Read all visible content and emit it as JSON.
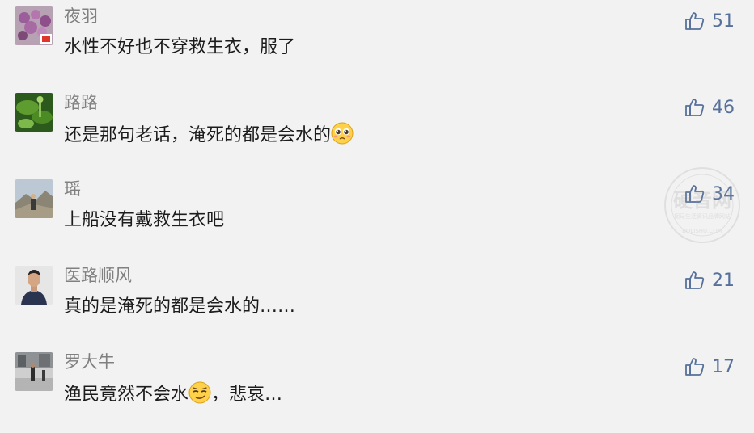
{
  "comments": [
    {
      "name": "夜羽",
      "text": "水性不好也不穿救生衣，服了",
      "likes": "51",
      "avatar_icon": "purple-flower-avatar"
    },
    {
      "name": "路路",
      "text": "还是那句老话，淹死的都是会水的",
      "emoji": "pleading-face-emoji",
      "likes": "46",
      "avatar_icon": "green-plant-avatar"
    },
    {
      "name": "瑶",
      "text": "上船没有戴救生衣吧",
      "likes": "34",
      "avatar_icon": "mountain-photo-avatar"
    },
    {
      "name": "医路顺风",
      "text": "真的是淹死的都是会水的……",
      "likes": "21",
      "avatar_icon": "man-portrait-avatar"
    },
    {
      "name": "罗大牛",
      "text": "渔民竟然不会水",
      "emoji": "smirk-face-emoji",
      "text_after": "，悲哀…",
      "likes": "17",
      "avatar_icon": "street-photo-avatar"
    }
  ],
  "watermark": {
    "main": "硬音网",
    "sub": "掘马生活资讯品牌网站",
    "url": "BOLISHU.COM"
  },
  "colors": {
    "background": "#f2f2f2",
    "name": "#808080",
    "text": "#1c1c1c",
    "like": "#56709b"
  }
}
